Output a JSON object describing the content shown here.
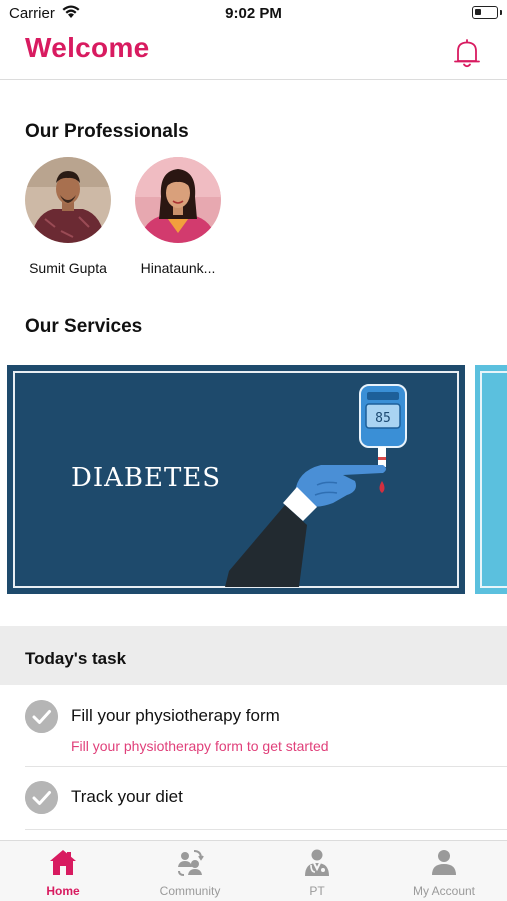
{
  "status_bar": {
    "carrier": "Carrier",
    "time": "9:02 PM"
  },
  "header": {
    "title": "Welcome"
  },
  "professionals": {
    "title": "Our Professionals",
    "items": [
      {
        "name": "Sumit Gupta"
      },
      {
        "name": "Hinataunk..."
      }
    ]
  },
  "services": {
    "title": "Our Services",
    "items": [
      {
        "label": "DIABETES",
        "meter_reading": "85"
      }
    ]
  },
  "tasks": {
    "title": "Today's task",
    "items": [
      {
        "title": "Fill your physiotherapy form",
        "subtitle": "Fill your physiotherapy form to get started"
      },
      {
        "title": "Track your diet"
      }
    ]
  },
  "tabbar": {
    "items": [
      {
        "label": "Home",
        "icon": "home-icon",
        "active": true
      },
      {
        "label": "Community",
        "icon": "community-icon"
      },
      {
        "label": "PT",
        "icon": "doctor-icon"
      },
      {
        "label": "My Account",
        "icon": "user-icon"
      }
    ]
  },
  "colors": {
    "brand": "#d81b60",
    "service_card": "#1e4a6c",
    "inactive_tab": "#9a9a9a"
  }
}
